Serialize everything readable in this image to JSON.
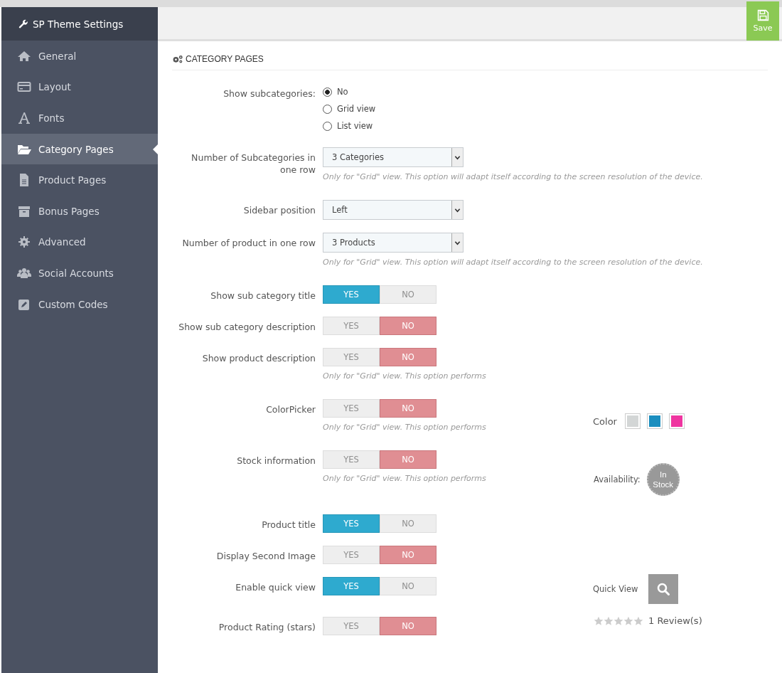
{
  "sidebar": {
    "title": "SP Theme Settings",
    "items": [
      {
        "label": "General",
        "selected": false
      },
      {
        "label": "Layout",
        "selected": false
      },
      {
        "label": "Fonts",
        "selected": false
      },
      {
        "label": "Category Pages",
        "selected": true
      },
      {
        "label": "Product Pages",
        "selected": false
      },
      {
        "label": "Bonus Pages",
        "selected": false
      },
      {
        "label": "Advanced",
        "selected": false
      },
      {
        "label": "Social Accounts",
        "selected": false
      },
      {
        "label": "Custom Codes",
        "selected": false
      }
    ]
  },
  "toolbar": {
    "save": "Save"
  },
  "panel": {
    "title": "CATEGORY PAGES",
    "rows": [
      {
        "kind": "radio",
        "label": "Show subcategories:",
        "options": [
          {
            "label": "No",
            "selected": true
          },
          {
            "label": "Grid view",
            "selected": false
          },
          {
            "label": "List view",
            "selected": false
          }
        ]
      },
      {
        "kind": "select",
        "label": "Number of Subcategories in one row",
        "value": "3 Categories",
        "hint": "Only for \"Grid\" view. This option will adapt itself according to the screen resolution of the device."
      },
      {
        "kind": "select",
        "label": "Sidebar position",
        "value": "Left"
      },
      {
        "kind": "select",
        "label": "Number of product in one row",
        "value": "3 Products",
        "hint": "Only for \"Grid\" view. This option will adapt itself according to the screen resolution of the device."
      },
      {
        "kind": "toggle",
        "label": "Show sub category title",
        "yes": "YES",
        "no": "NO",
        "on": true
      },
      {
        "kind": "toggle",
        "label": "Show sub category description",
        "yes": "YES",
        "no": "NO",
        "on": false
      },
      {
        "kind": "toggle",
        "label": "Show product description",
        "yes": "YES",
        "no": "NO",
        "on": false,
        "hint": "Only for \"Grid\" view. This option performs"
      },
      {
        "kind": "toggle",
        "label": "ColorPicker",
        "yes": "YES",
        "no": "NO",
        "on": false,
        "hint": "Only for \"Grid\" view. This option performs",
        "preview": {
          "kind": "colors",
          "label": "Color",
          "swatches": [
            {
              "color": "#d3d6d6"
            },
            {
              "color": "#1b8ebf"
            },
            {
              "color": "#ef35a0"
            }
          ]
        }
      },
      {
        "kind": "toggle",
        "label": "Stock information",
        "yes": "YES",
        "no": "NO",
        "on": false,
        "hint": "Only for \"Grid\" view. This option performs",
        "preview": {
          "kind": "stock",
          "label": "Availability:",
          "badge": "In Stock"
        }
      },
      {
        "kind": "toggle",
        "label": "Product title",
        "yes": "YES",
        "no": "NO",
        "on": true
      },
      {
        "kind": "toggle",
        "label": "Display Second Image",
        "yes": "YES",
        "no": "NO",
        "on": false
      },
      {
        "kind": "toggle",
        "label": "Enable quick view",
        "yes": "YES",
        "no": "NO",
        "on": true,
        "preview": {
          "kind": "quickview",
          "label": "Quick View"
        }
      },
      {
        "kind": "toggle",
        "label": "Product Rating (stars)",
        "yes": "YES",
        "no": "NO",
        "on": false,
        "preview": {
          "kind": "rating",
          "stars": 0,
          "reviews": "1 Review(s)"
        }
      }
    ]
  }
}
